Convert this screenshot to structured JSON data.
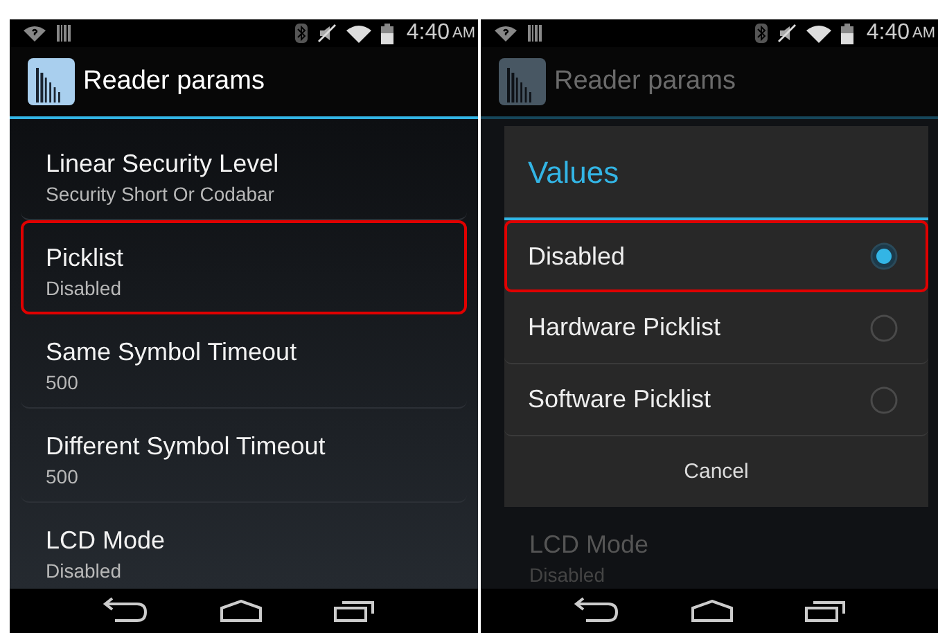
{
  "screens": [
    {
      "status_bar": {
        "time": "4:40",
        "meridiem": "AM"
      },
      "action_bar": {
        "title": "Reader params"
      },
      "dimmed": false,
      "settings": [
        {
          "title": "Linear Security Level",
          "summary": "Security Short Or Codabar",
          "highlighted": false
        },
        {
          "title": "Picklist",
          "summary": "Disabled",
          "highlighted": true
        },
        {
          "title": "Same Symbol Timeout",
          "summary": "500",
          "highlighted": false
        },
        {
          "title": "Different Symbol Timeout",
          "summary": "500",
          "highlighted": false
        },
        {
          "title": "LCD Mode",
          "summary": "Disabled",
          "highlighted": false
        }
      ]
    },
    {
      "status_bar": {
        "time": "4:40",
        "meridiem": "AM"
      },
      "action_bar": {
        "title": "Reader params"
      },
      "dimmed": true,
      "dialog": {
        "title": "Values",
        "options": [
          {
            "label": "Disabled",
            "selected": true,
            "highlighted": true
          },
          {
            "label": "Hardware Picklist",
            "selected": false,
            "highlighted": false
          },
          {
            "label": "Software Picklist",
            "selected": false,
            "highlighted": false
          }
        ],
        "button": "Cancel"
      },
      "settings": [
        {
          "title": "LCD Mode",
          "summary": "Disabled",
          "highlighted": false
        }
      ]
    }
  ]
}
